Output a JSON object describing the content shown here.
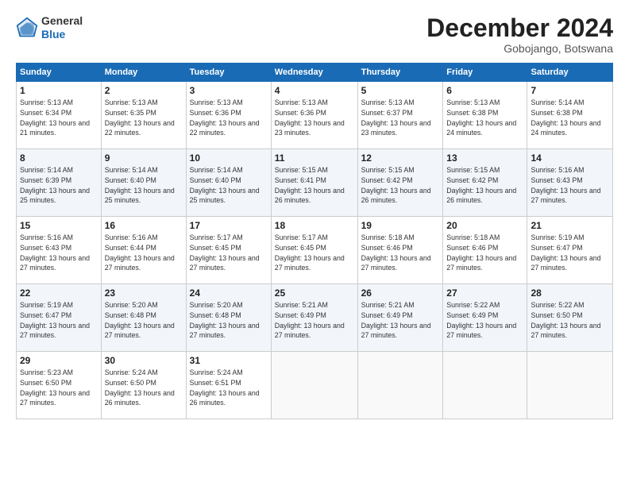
{
  "header": {
    "logo": {
      "general": "General",
      "blue": "Blue"
    },
    "title": "December 2024",
    "location": "Gobojango, Botswana"
  },
  "calendar": {
    "columns": [
      "Sunday",
      "Monday",
      "Tuesday",
      "Wednesday",
      "Thursday",
      "Friday",
      "Saturday"
    ],
    "rows": [
      [
        {
          "day": "1",
          "sunrise": "Sunrise: 5:13 AM",
          "sunset": "Sunset: 6:34 PM",
          "daylight": "Daylight: 13 hours and 21 minutes."
        },
        {
          "day": "2",
          "sunrise": "Sunrise: 5:13 AM",
          "sunset": "Sunset: 6:35 PM",
          "daylight": "Daylight: 13 hours and 22 minutes."
        },
        {
          "day": "3",
          "sunrise": "Sunrise: 5:13 AM",
          "sunset": "Sunset: 6:36 PM",
          "daylight": "Daylight: 13 hours and 22 minutes."
        },
        {
          "day": "4",
          "sunrise": "Sunrise: 5:13 AM",
          "sunset": "Sunset: 6:36 PM",
          "daylight": "Daylight: 13 hours and 23 minutes."
        },
        {
          "day": "5",
          "sunrise": "Sunrise: 5:13 AM",
          "sunset": "Sunset: 6:37 PM",
          "daylight": "Daylight: 13 hours and 23 minutes."
        },
        {
          "day": "6",
          "sunrise": "Sunrise: 5:13 AM",
          "sunset": "Sunset: 6:38 PM",
          "daylight": "Daylight: 13 hours and 24 minutes."
        },
        {
          "day": "7",
          "sunrise": "Sunrise: 5:14 AM",
          "sunset": "Sunset: 6:38 PM",
          "daylight": "Daylight: 13 hours and 24 minutes."
        }
      ],
      [
        {
          "day": "8",
          "sunrise": "Sunrise: 5:14 AM",
          "sunset": "Sunset: 6:39 PM",
          "daylight": "Daylight: 13 hours and 25 minutes."
        },
        {
          "day": "9",
          "sunrise": "Sunrise: 5:14 AM",
          "sunset": "Sunset: 6:40 PM",
          "daylight": "Daylight: 13 hours and 25 minutes."
        },
        {
          "day": "10",
          "sunrise": "Sunrise: 5:14 AM",
          "sunset": "Sunset: 6:40 PM",
          "daylight": "Daylight: 13 hours and 25 minutes."
        },
        {
          "day": "11",
          "sunrise": "Sunrise: 5:15 AM",
          "sunset": "Sunset: 6:41 PM",
          "daylight": "Daylight: 13 hours and 26 minutes."
        },
        {
          "day": "12",
          "sunrise": "Sunrise: 5:15 AM",
          "sunset": "Sunset: 6:42 PM",
          "daylight": "Daylight: 13 hours and 26 minutes."
        },
        {
          "day": "13",
          "sunrise": "Sunrise: 5:15 AM",
          "sunset": "Sunset: 6:42 PM",
          "daylight": "Daylight: 13 hours and 26 minutes."
        },
        {
          "day": "14",
          "sunrise": "Sunrise: 5:16 AM",
          "sunset": "Sunset: 6:43 PM",
          "daylight": "Daylight: 13 hours and 27 minutes."
        }
      ],
      [
        {
          "day": "15",
          "sunrise": "Sunrise: 5:16 AM",
          "sunset": "Sunset: 6:43 PM",
          "daylight": "Daylight: 13 hours and 27 minutes."
        },
        {
          "day": "16",
          "sunrise": "Sunrise: 5:16 AM",
          "sunset": "Sunset: 6:44 PM",
          "daylight": "Daylight: 13 hours and 27 minutes."
        },
        {
          "day": "17",
          "sunrise": "Sunrise: 5:17 AM",
          "sunset": "Sunset: 6:45 PM",
          "daylight": "Daylight: 13 hours and 27 minutes."
        },
        {
          "day": "18",
          "sunrise": "Sunrise: 5:17 AM",
          "sunset": "Sunset: 6:45 PM",
          "daylight": "Daylight: 13 hours and 27 minutes."
        },
        {
          "day": "19",
          "sunrise": "Sunrise: 5:18 AM",
          "sunset": "Sunset: 6:46 PM",
          "daylight": "Daylight: 13 hours and 27 minutes."
        },
        {
          "day": "20",
          "sunrise": "Sunrise: 5:18 AM",
          "sunset": "Sunset: 6:46 PM",
          "daylight": "Daylight: 13 hours and 27 minutes."
        },
        {
          "day": "21",
          "sunrise": "Sunrise: 5:19 AM",
          "sunset": "Sunset: 6:47 PM",
          "daylight": "Daylight: 13 hours and 27 minutes."
        }
      ],
      [
        {
          "day": "22",
          "sunrise": "Sunrise: 5:19 AM",
          "sunset": "Sunset: 6:47 PM",
          "daylight": "Daylight: 13 hours and 27 minutes."
        },
        {
          "day": "23",
          "sunrise": "Sunrise: 5:20 AM",
          "sunset": "Sunset: 6:48 PM",
          "daylight": "Daylight: 13 hours and 27 minutes."
        },
        {
          "day": "24",
          "sunrise": "Sunrise: 5:20 AM",
          "sunset": "Sunset: 6:48 PM",
          "daylight": "Daylight: 13 hours and 27 minutes."
        },
        {
          "day": "25",
          "sunrise": "Sunrise: 5:21 AM",
          "sunset": "Sunset: 6:49 PM",
          "daylight": "Daylight: 13 hours and 27 minutes."
        },
        {
          "day": "26",
          "sunrise": "Sunrise: 5:21 AM",
          "sunset": "Sunset: 6:49 PM",
          "daylight": "Daylight: 13 hours and 27 minutes."
        },
        {
          "day": "27",
          "sunrise": "Sunrise: 5:22 AM",
          "sunset": "Sunset: 6:49 PM",
          "daylight": "Daylight: 13 hours and 27 minutes."
        },
        {
          "day": "28",
          "sunrise": "Sunrise: 5:22 AM",
          "sunset": "Sunset: 6:50 PM",
          "daylight": "Daylight: 13 hours and 27 minutes."
        }
      ],
      [
        {
          "day": "29",
          "sunrise": "Sunrise: 5:23 AM",
          "sunset": "Sunset: 6:50 PM",
          "daylight": "Daylight: 13 hours and 27 minutes."
        },
        {
          "day": "30",
          "sunrise": "Sunrise: 5:24 AM",
          "sunset": "Sunset: 6:50 PM",
          "daylight": "Daylight: 13 hours and 26 minutes."
        },
        {
          "day": "31",
          "sunrise": "Sunrise: 5:24 AM",
          "sunset": "Sunset: 6:51 PM",
          "daylight": "Daylight: 13 hours and 26 minutes."
        },
        null,
        null,
        null,
        null
      ]
    ]
  }
}
